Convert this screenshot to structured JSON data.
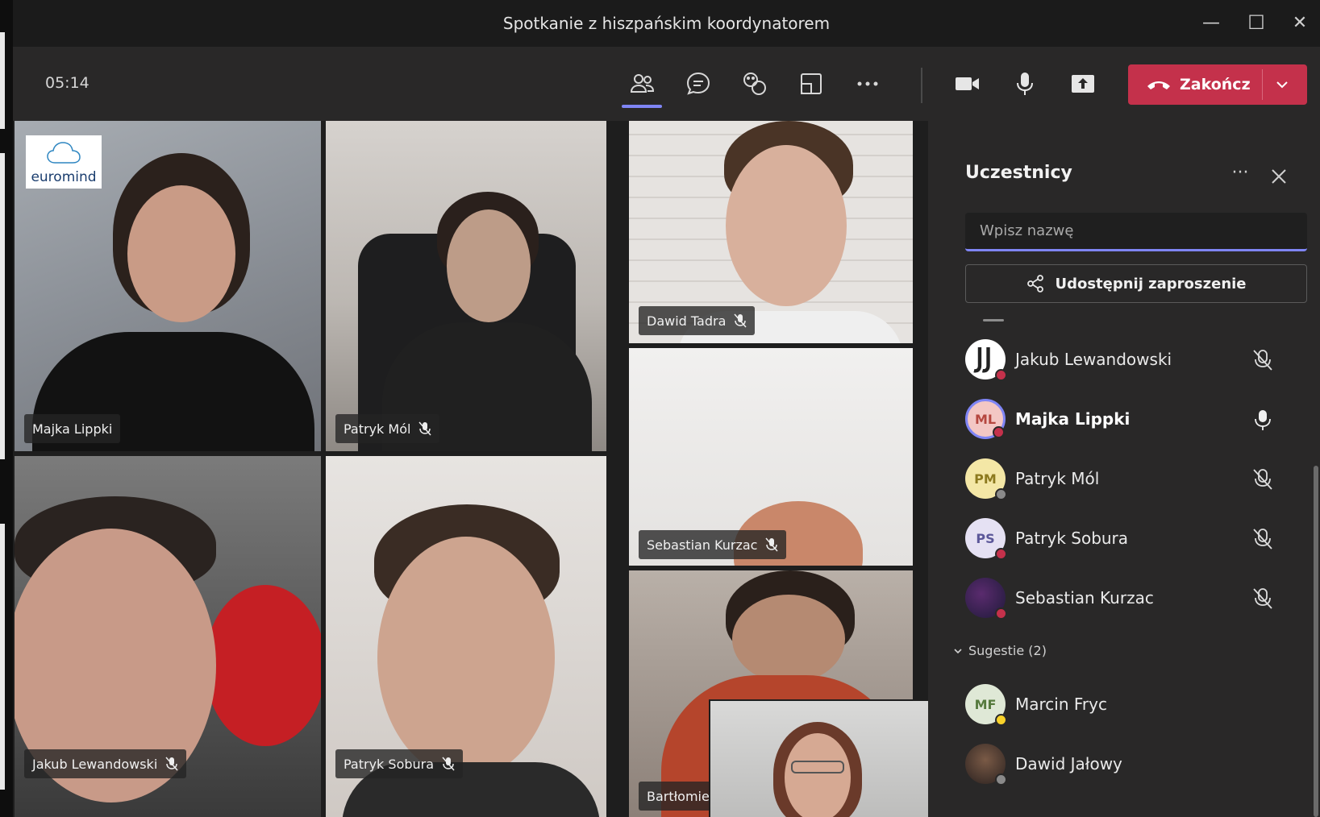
{
  "window": {
    "title": "Spotkanie z hiszpańskim koordynatorem",
    "minimize_glyph": "—",
    "maximize_glyph": "☐",
    "close_glyph": "✕"
  },
  "toolbar": {
    "timer": "05:14",
    "icons": [
      "people-icon",
      "chat-icon",
      "reactions-icon",
      "rooms-icon",
      "more-icon",
      "camera-icon",
      "microphone-icon",
      "share-screen-icon"
    ],
    "end_call_label": "Zakończ",
    "end_call_color": "#c4314b",
    "active_color": "#7f85f5"
  },
  "stage": {
    "logo_text": "euromind",
    "tiles": [
      {
        "name": "Majka Lippki"
      },
      {
        "name": "Patryk Mól"
      },
      {
        "name": "Dawid Tadra"
      },
      {
        "name": "Sebastian Kurzac"
      },
      {
        "name": "Jakub Lewandowski"
      },
      {
        "name": "Patryk Sobura"
      },
      {
        "name": "Bartłomie"
      }
    ]
  },
  "panel": {
    "title": "Uczestnicy",
    "more_glyph": "···",
    "search_placeholder": "Wpisz nazwę",
    "share_label": "Udostępnij zaproszenie",
    "participants": [
      {
        "name": "Jakub Lewandowski",
        "initials": "",
        "mic": "muted",
        "status": "busy"
      },
      {
        "name": "Majka Lippki",
        "initials": "ML",
        "mic": "on",
        "status": "busy"
      },
      {
        "name": "Patryk Mól",
        "initials": "PM",
        "mic": "muted",
        "status": "offline"
      },
      {
        "name": "Patryk Sobura",
        "initials": "PS",
        "mic": "muted",
        "status": "busy"
      },
      {
        "name": "Sebastian Kurzac",
        "initials": "",
        "mic": "muted",
        "status": "busy"
      }
    ],
    "suggestions_label": "Sugestie (2)",
    "suggestions": [
      {
        "name": "Marcin Fryc",
        "initials": "MF",
        "status": "away"
      },
      {
        "name": "Dawid Jałowy",
        "initials": "",
        "status": "offline"
      }
    ]
  }
}
